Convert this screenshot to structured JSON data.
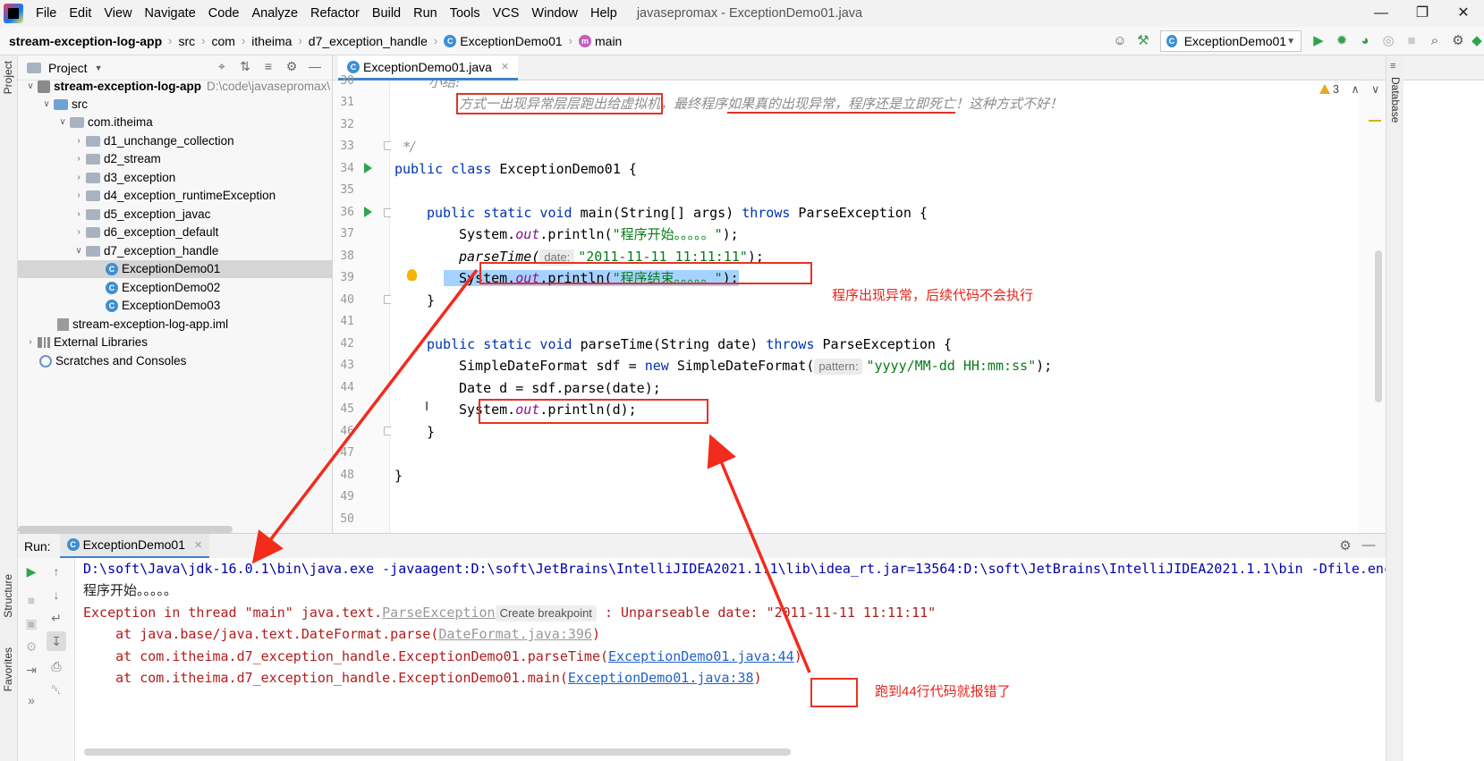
{
  "menu": {
    "items": [
      "File",
      "Edit",
      "View",
      "Navigate",
      "Code",
      "Analyze",
      "Refactor",
      "Build",
      "Run",
      "Tools",
      "VCS",
      "Window",
      "Help"
    ],
    "window_title": "javasepromax - ExceptionDemo01.java"
  },
  "breadcrumbs": [
    "stream-exception-log-app",
    "src",
    "com",
    "itheima",
    "d7_exception_handle",
    "ExceptionDemo01",
    "main"
  ],
  "toolbar": {
    "run_config": "ExceptionDemo01",
    "icons": [
      "user-icon",
      "build-hammer-icon",
      "run-icon",
      "debug-icon",
      "coverage-icon",
      "profile-icon",
      "stop-icon",
      "search-icon",
      "settings-icon"
    ]
  },
  "side_tabs": {
    "left_top": "Project",
    "left_structure": "Structure",
    "left_favorites": "Favorites",
    "right_database": "Database"
  },
  "project": {
    "title": "Project",
    "root_name": "stream-exception-log-app",
    "root_path": "D:\\code\\javasepromax\\",
    "tree": [
      {
        "label": "src",
        "depth": 1
      },
      {
        "label": "com.itheima",
        "depth": 2
      },
      {
        "label": "d1_unchange_collection",
        "depth": 3
      },
      {
        "label": "d2_stream",
        "depth": 3
      },
      {
        "label": "d3_exception",
        "depth": 3
      },
      {
        "label": "d4_exception_runtimeException",
        "depth": 3
      },
      {
        "label": "d5_exception_javac",
        "depth": 3
      },
      {
        "label": "d6_exception_default",
        "depth": 3
      },
      {
        "label": "d7_exception_handle",
        "depth": 3
      },
      {
        "label": "ExceptionDemo01",
        "depth": 4
      },
      {
        "label": "ExceptionDemo02",
        "depth": 4
      },
      {
        "label": "ExceptionDemo03",
        "depth": 4
      },
      {
        "label": "stream-exception-log-app.iml",
        "depth": 2
      },
      {
        "label": "External Libraries",
        "depth": 0
      },
      {
        "label": "Scratches and Consoles",
        "depth": 0
      }
    ]
  },
  "editor": {
    "tab_label": "ExceptionDemo01.java",
    "warnings": "3",
    "line_numbers": [
      "30",
      "31",
      "32",
      "33",
      "34",
      "35",
      "36",
      "37",
      "38",
      "39",
      "40",
      "41",
      "42",
      "43",
      "44",
      "45",
      "46",
      "47",
      "48",
      "49",
      "50"
    ],
    "code": {
      "l30": "小结:",
      "l31_a": "方式一出现异常层层跑出给虚拟机",
      "l31_b": "，最终程序",
      "l31_c": "如果真的出现异常，程序还是立即死亡",
      "l31_d": "！这种方式不好！",
      "l33": "*/",
      "l34_kw": "public class",
      "l34_rest": " ExceptionDemo01 {",
      "l36_kw": "public static void",
      "l36_mid": " main(String[] args) ",
      "l36_kw2": "throws",
      "l36_rest": " ParseException {",
      "l37_a": "System.",
      "l37_out": "out",
      "l37_b": ".println(",
      "l37_str": "\"程序开始。。。。。\"",
      "l37_c": ");",
      "l38_call": "parseTime(",
      "l38_hint": "date:",
      "l38_str": "\"2011-11-11 11:11:11\"",
      "l38_end": ");",
      "l39_a": "System.",
      "l39_out": "out",
      "l39_b": ".println(",
      "l39_str": "\"程序结束。。。。。\"",
      "l39_c": ");",
      "l40": "}",
      "l42_kw": "public static void",
      "l42_mid": " parseTime(String date) ",
      "l42_kw2": "throws",
      "l42_rest": " ParseException {",
      "l43_a": "SimpleDateFormat sdf = ",
      "l43_kw": "new",
      "l43_b": " SimpleDateFormat(",
      "l43_hint": "pattern:",
      "l43_str": "\"yyyy/MM-dd HH:mm:ss\"",
      "l43_c": ");",
      "l44": "Date d = sdf.parse(date);",
      "l45_a": "System.",
      "l45_out": "out",
      "l45_b": ".println(d);",
      "l46": "}",
      "l48": "}"
    }
  },
  "run": {
    "label": "Run:",
    "tab_label": "ExceptionDemo01",
    "console": {
      "line1": "D:\\soft\\Java\\jdk-16.0.1\\bin\\java.exe -javaagent:D:\\soft\\JetBrains\\IntelliJIDEA2021.1.1\\lib\\idea_rt.jar=13564:D:\\soft\\JetBrains\\IntelliJIDEA2021.1.1\\bin -Dfile.enc",
      "line2": "程序开始。。。。。",
      "line3_a": "Exception in thread \"main\" java.text.",
      "line3_link": "ParseException",
      "line3_hint": "Create breakpoint",
      "line3_b": " : Unparseable date: \"2011-11-11 11:11:11\"",
      "line4_a": "    at java.base/java.text.DateFormat.parse(",
      "line4_link": "DateFormat.java:396",
      "line4_b": ")",
      "line5_a": "    at com.itheima.d7_exception_handle.ExceptionDemo01.parseTime(",
      "line5_link": "ExceptionDemo01.java:44",
      "line5_b": ")",
      "line6_a": "    at com.itheima.d7_exception_handle.ExceptionDemo01.main(",
      "line6_link": "ExceptionDemo01.java:38",
      "line6_b": ")"
    }
  },
  "annotations": {
    "note_line39": "程序出现异常，后续代码不会执行",
    "note_console": "跑到44行代码就报错了",
    "color": "#e53225"
  },
  "colors": {
    "keyword": "#0033b3",
    "string": "#067d17",
    "field": "#871094",
    "selection": "#a6d2ff",
    "console_error": "#b31b1b",
    "console_link": "#2162c9"
  }
}
